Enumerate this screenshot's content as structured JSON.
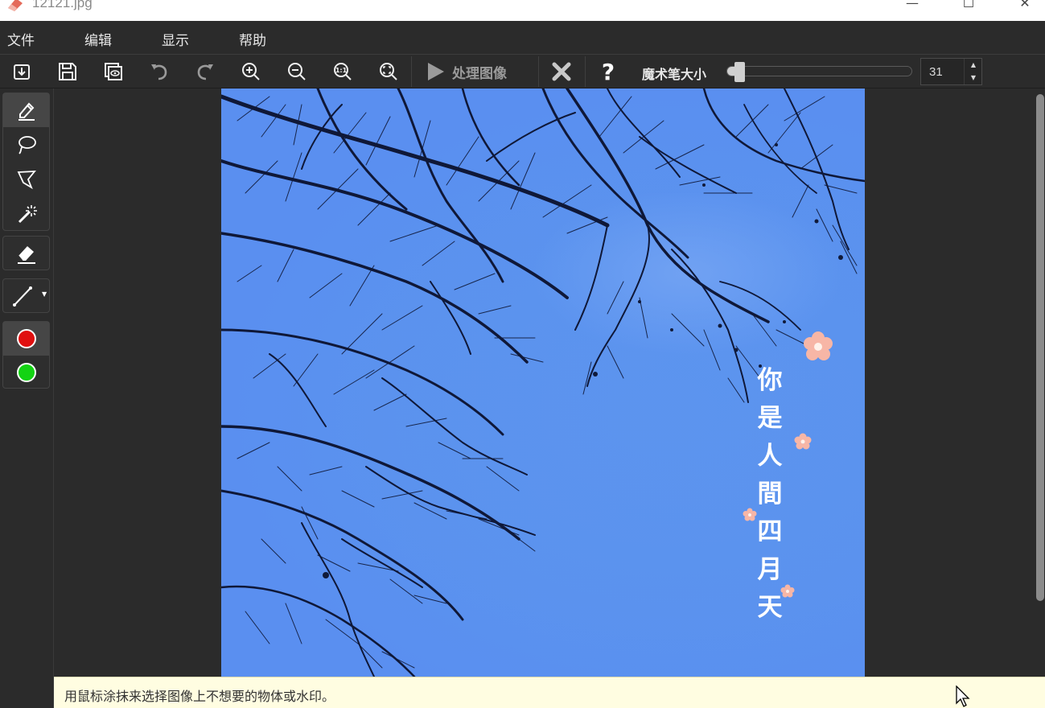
{
  "window": {
    "title": "12121.jpg",
    "minimize": "—",
    "maximize": "☐",
    "close": "✕"
  },
  "menu": {
    "items": [
      {
        "label": "文件"
      },
      {
        "label": "编辑"
      },
      {
        "label": "显示"
      },
      {
        "label": "帮助"
      }
    ]
  },
  "toolbar": {
    "icons": [
      "open-icon",
      "save-icon",
      "compare-icon",
      "undo-icon",
      "redo-icon",
      "zoom-in-icon",
      "zoom-out-icon",
      "zoom-actual-icon",
      "zoom-fit-icon"
    ],
    "process_label": "处理图像",
    "clear_icon": "clear-icon",
    "help_label": "?",
    "brush_size_label": "魔术笔大小",
    "brush_size_value": "31",
    "brush_size_fraction": 0.02
  },
  "tools": {
    "selection": [
      "marker-icon",
      "lasso-icon",
      "polygon-lasso-icon",
      "magic-wand-icon"
    ],
    "eraser": "eraser-icon",
    "line": "line-icon",
    "colors": [
      "#e01010",
      "#13d313"
    ]
  },
  "image": {
    "poem": [
      "你",
      "是",
      "人",
      "間",
      "四",
      "月",
      "天"
    ]
  },
  "status": {
    "message": "用鼠标涂抹来选择图像上不想要的物体或水印。"
  },
  "colors": {
    "background": "#2b2b2b",
    "sky": "#5a8ff0",
    "branch": "#101a3a",
    "status_bg": "#fffde1",
    "blossom": "#f7b6a6"
  }
}
